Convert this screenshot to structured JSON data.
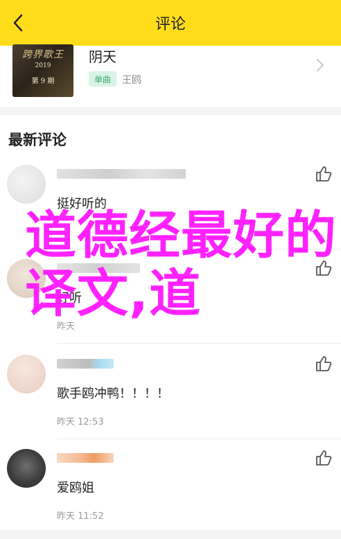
{
  "header": {
    "title": "评论"
  },
  "song": {
    "name": "阴天",
    "tag": "单曲",
    "singer": "王鸥",
    "cover": {
      "brand": "跨界歌王",
      "year": "2019",
      "episode": "第 9 期"
    }
  },
  "section": {
    "title": "最新评论"
  },
  "comments": [
    {
      "text": "挺好听的",
      "time": "",
      "user_colors": [
        "#d8d8d8",
        "#c9c9c9"
      ]
    },
    {
      "text": "好听",
      "time": "昨天 ",
      "user_colors": [
        "#ddd",
        "#cfcfcf"
      ]
    },
    {
      "text": "歌手鸥冲鸭！！！！",
      "time": "昨天 12:53",
      "user_colors": [
        "#cfcfcf",
        "#b7e0f2"
      ]
    },
    {
      "text": "爱鸥姐",
      "time": "昨天 11:52",
      "user_colors": [
        "#f6c9a7",
        "#f2a06a"
      ]
    }
  ],
  "overlay": {
    "text": "道德经最好的译文,道"
  },
  "colors": {
    "header_bg": "#ffdd1a",
    "tag_bg": "#d9f3e6",
    "tag_fg": "#3dab76",
    "overlay": "#ff22ff"
  }
}
